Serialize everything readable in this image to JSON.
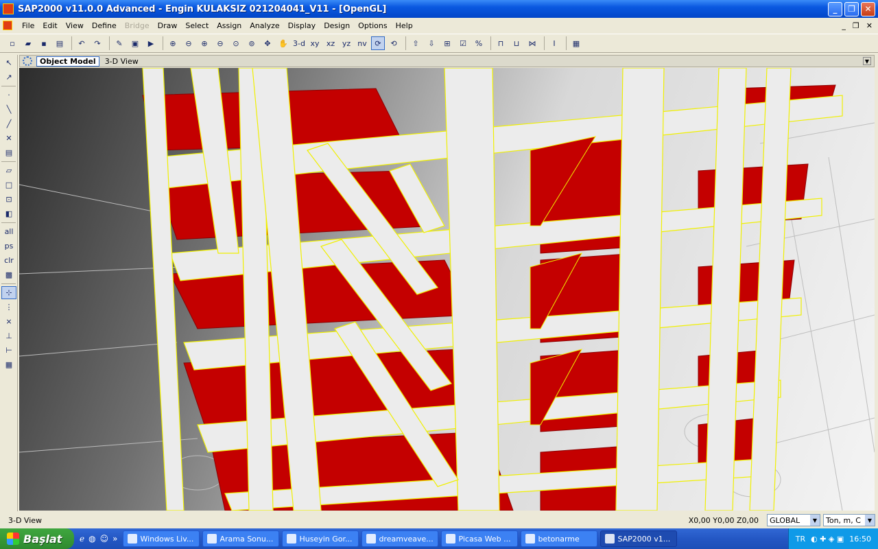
{
  "window": {
    "title": "SAP2000 v11.0.0 Advanced  - Engin KULAKSIZ 021204041_V11 - [OpenGL]"
  },
  "menu": {
    "items": [
      {
        "label": "File",
        "enabled": true
      },
      {
        "label": "Edit",
        "enabled": true
      },
      {
        "label": "View",
        "enabled": true
      },
      {
        "label": "Define",
        "enabled": true
      },
      {
        "label": "Bridge",
        "enabled": false
      },
      {
        "label": "Draw",
        "enabled": true
      },
      {
        "label": "Select",
        "enabled": true
      },
      {
        "label": "Assign",
        "enabled": true
      },
      {
        "label": "Analyze",
        "enabled": true
      },
      {
        "label": "Display",
        "enabled": true
      },
      {
        "label": "Design",
        "enabled": true
      },
      {
        "label": "Options",
        "enabled": true
      },
      {
        "label": "Help",
        "enabled": true
      }
    ]
  },
  "toolbar": {
    "view_3d": "3-d",
    "view_xy": "xy",
    "view_xz": "xz",
    "view_yz": "yz",
    "view_nv": "nv"
  },
  "viewport": {
    "tab_label": "Object Model",
    "view_title": "3-D View"
  },
  "left_tools": {
    "all": "all",
    "ps": "ps",
    "clr": "clr"
  },
  "status": {
    "left": "3-D View",
    "coords": "X0,00  Y0,00  Z0,00",
    "coord_system": "GLOBAL",
    "units": "Ton, m, C"
  },
  "taskbar": {
    "start": "Başlat",
    "tasks": [
      "Windows Liv...",
      "Arama Sonu...",
      "Huseyin Gor...",
      "dreamveave...",
      "Picasa Web ...",
      "betonarme",
      "SAP2000 v1..."
    ],
    "active_index": 6,
    "lang": "TR",
    "clock": "16:50"
  },
  "colors": {
    "slab": "#c40000",
    "frame": "#ececec",
    "edge": "#f0f000"
  }
}
